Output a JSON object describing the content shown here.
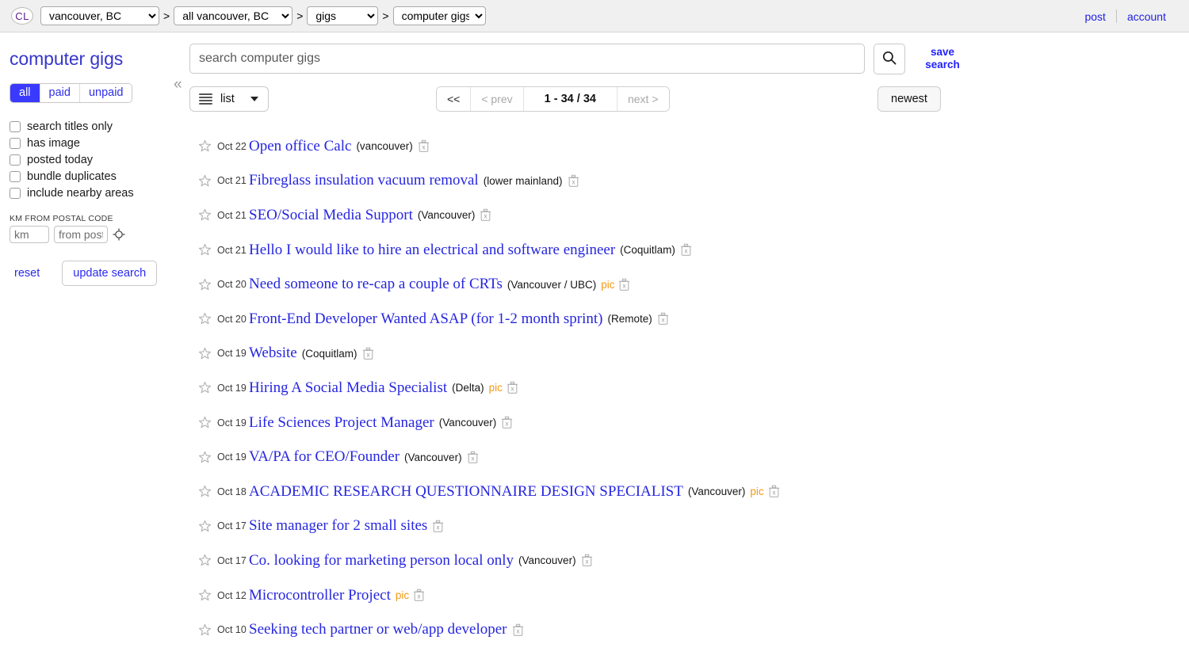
{
  "header": {
    "logo": "CL",
    "logo_icon": "cl-circle-logo",
    "breadcrumbs": [
      {
        "name": "area",
        "value": "vancouver, BC"
      },
      {
        "name": "subarea",
        "value": "all vancouver, BC"
      },
      {
        "name": "category",
        "value": "gigs"
      },
      {
        "name": "subcategory",
        "value": "computer gigs"
      }
    ],
    "separator": ">",
    "post_label": "post",
    "account_label": "account"
  },
  "sidebar": {
    "title": "computer gigs",
    "pay_filter": {
      "options": [
        "all",
        "paid",
        "unpaid"
      ],
      "selected": "all",
      "active_bg": "#3a3aff",
      "active_text": "#ffffff",
      "inactive_text": "#2f2fe8"
    },
    "checkboxes": [
      {
        "label": "search titles only",
        "checked": false
      },
      {
        "label": "has image",
        "checked": false
      },
      {
        "label": "posted today",
        "checked": false
      },
      {
        "label": "bundle duplicates",
        "checked": false
      },
      {
        "label": "include nearby areas",
        "checked": false
      }
    ],
    "postal": {
      "legend": "KM FROM POSTAL CODE",
      "distance_value": "",
      "distance_placeholder": "km",
      "postal_value": "",
      "postal_placeholder": "from postal",
      "geo_icon": "crosshair-icon"
    },
    "reset_label": "reset",
    "update_label": "update search"
  },
  "main": {
    "collapse_icon": "chevron-double-left-icon",
    "search": {
      "value": "",
      "placeholder": "search computer gigs",
      "button_icon": "search-icon",
      "save_search_label": "save\nsearch",
      "save_search_line1": "save",
      "save_search_line2": "search"
    },
    "toolbar": {
      "view_label": "list",
      "view_icon": "list-view-icon",
      "caret_icon": "chevron-down-icon",
      "sort_label": "newest",
      "pagination": {
        "first_label": "<<",
        "prev_label": "< prev",
        "count_label": "1 - 34 / 34",
        "next_label": "next >",
        "first_disabled": false,
        "prev_disabled": true,
        "next_disabled": true
      }
    },
    "results": [
      {
        "date": "Oct 22",
        "title": "Open office Calc",
        "hood": "(vancouver)",
        "pic": ""
      },
      {
        "date": "Oct 21",
        "title": "Fibreglass insulation vacuum removal",
        "hood": "(lower mainland)",
        "pic": ""
      },
      {
        "date": "Oct 21",
        "title": "SEO/Social Media Support",
        "hood": "(Vancouver)",
        "pic": ""
      },
      {
        "date": "Oct 21",
        "title": "Hello I would like to hire an electrical and software engineer",
        "hood": "(Coquitlam)",
        "pic": ""
      },
      {
        "date": "Oct 20",
        "title": "Need someone to re-cap a couple of CRTs",
        "hood": "(Vancouver / UBC)",
        "pic": "pic"
      },
      {
        "date": "Oct 20",
        "title": "Front-End Developer Wanted ASAP (for 1-2 month sprint)",
        "hood": "(Remote)",
        "pic": ""
      },
      {
        "date": "Oct 19",
        "title": "Website",
        "hood": "(Coquitlam)",
        "pic": ""
      },
      {
        "date": "Oct 19",
        "title": "Hiring A Social Media Specialist",
        "hood": "(Delta)",
        "pic": "pic"
      },
      {
        "date": "Oct 19",
        "title": "Life Sciences Project Manager",
        "hood": "(Vancouver)",
        "pic": ""
      },
      {
        "date": "Oct 19",
        "title": "VA/PA for CEO/Founder",
        "hood": "(Vancouver)",
        "pic": ""
      },
      {
        "date": "Oct 18",
        "title": "ACADEMIC RESEARCH QUESTIONNAIRE DESIGN SPECIALIST",
        "hood": "(Vancouver)",
        "pic": "pic"
      },
      {
        "date": "Oct 17",
        "title": "Site manager for 2 small sites",
        "hood": "",
        "pic": ""
      },
      {
        "date": "Oct 17",
        "title": "Co. looking for marketing person local only",
        "hood": "(Vancouver)",
        "pic": ""
      },
      {
        "date": "Oct 12",
        "title": "Microcontroller Project",
        "hood": "",
        "pic": "pic"
      },
      {
        "date": "Oct 10",
        "title": "Seeking tech partner or web/app developer",
        "hood": "",
        "pic": ""
      }
    ],
    "row_icons": {
      "favorite": "star-icon",
      "hide": "trash-hide-icon"
    }
  },
  "colors": {
    "link": "#2626e0",
    "pic_tag": "#f49914",
    "header_bg": "#f0f0f0",
    "accent_blue": "#3a3aff"
  }
}
